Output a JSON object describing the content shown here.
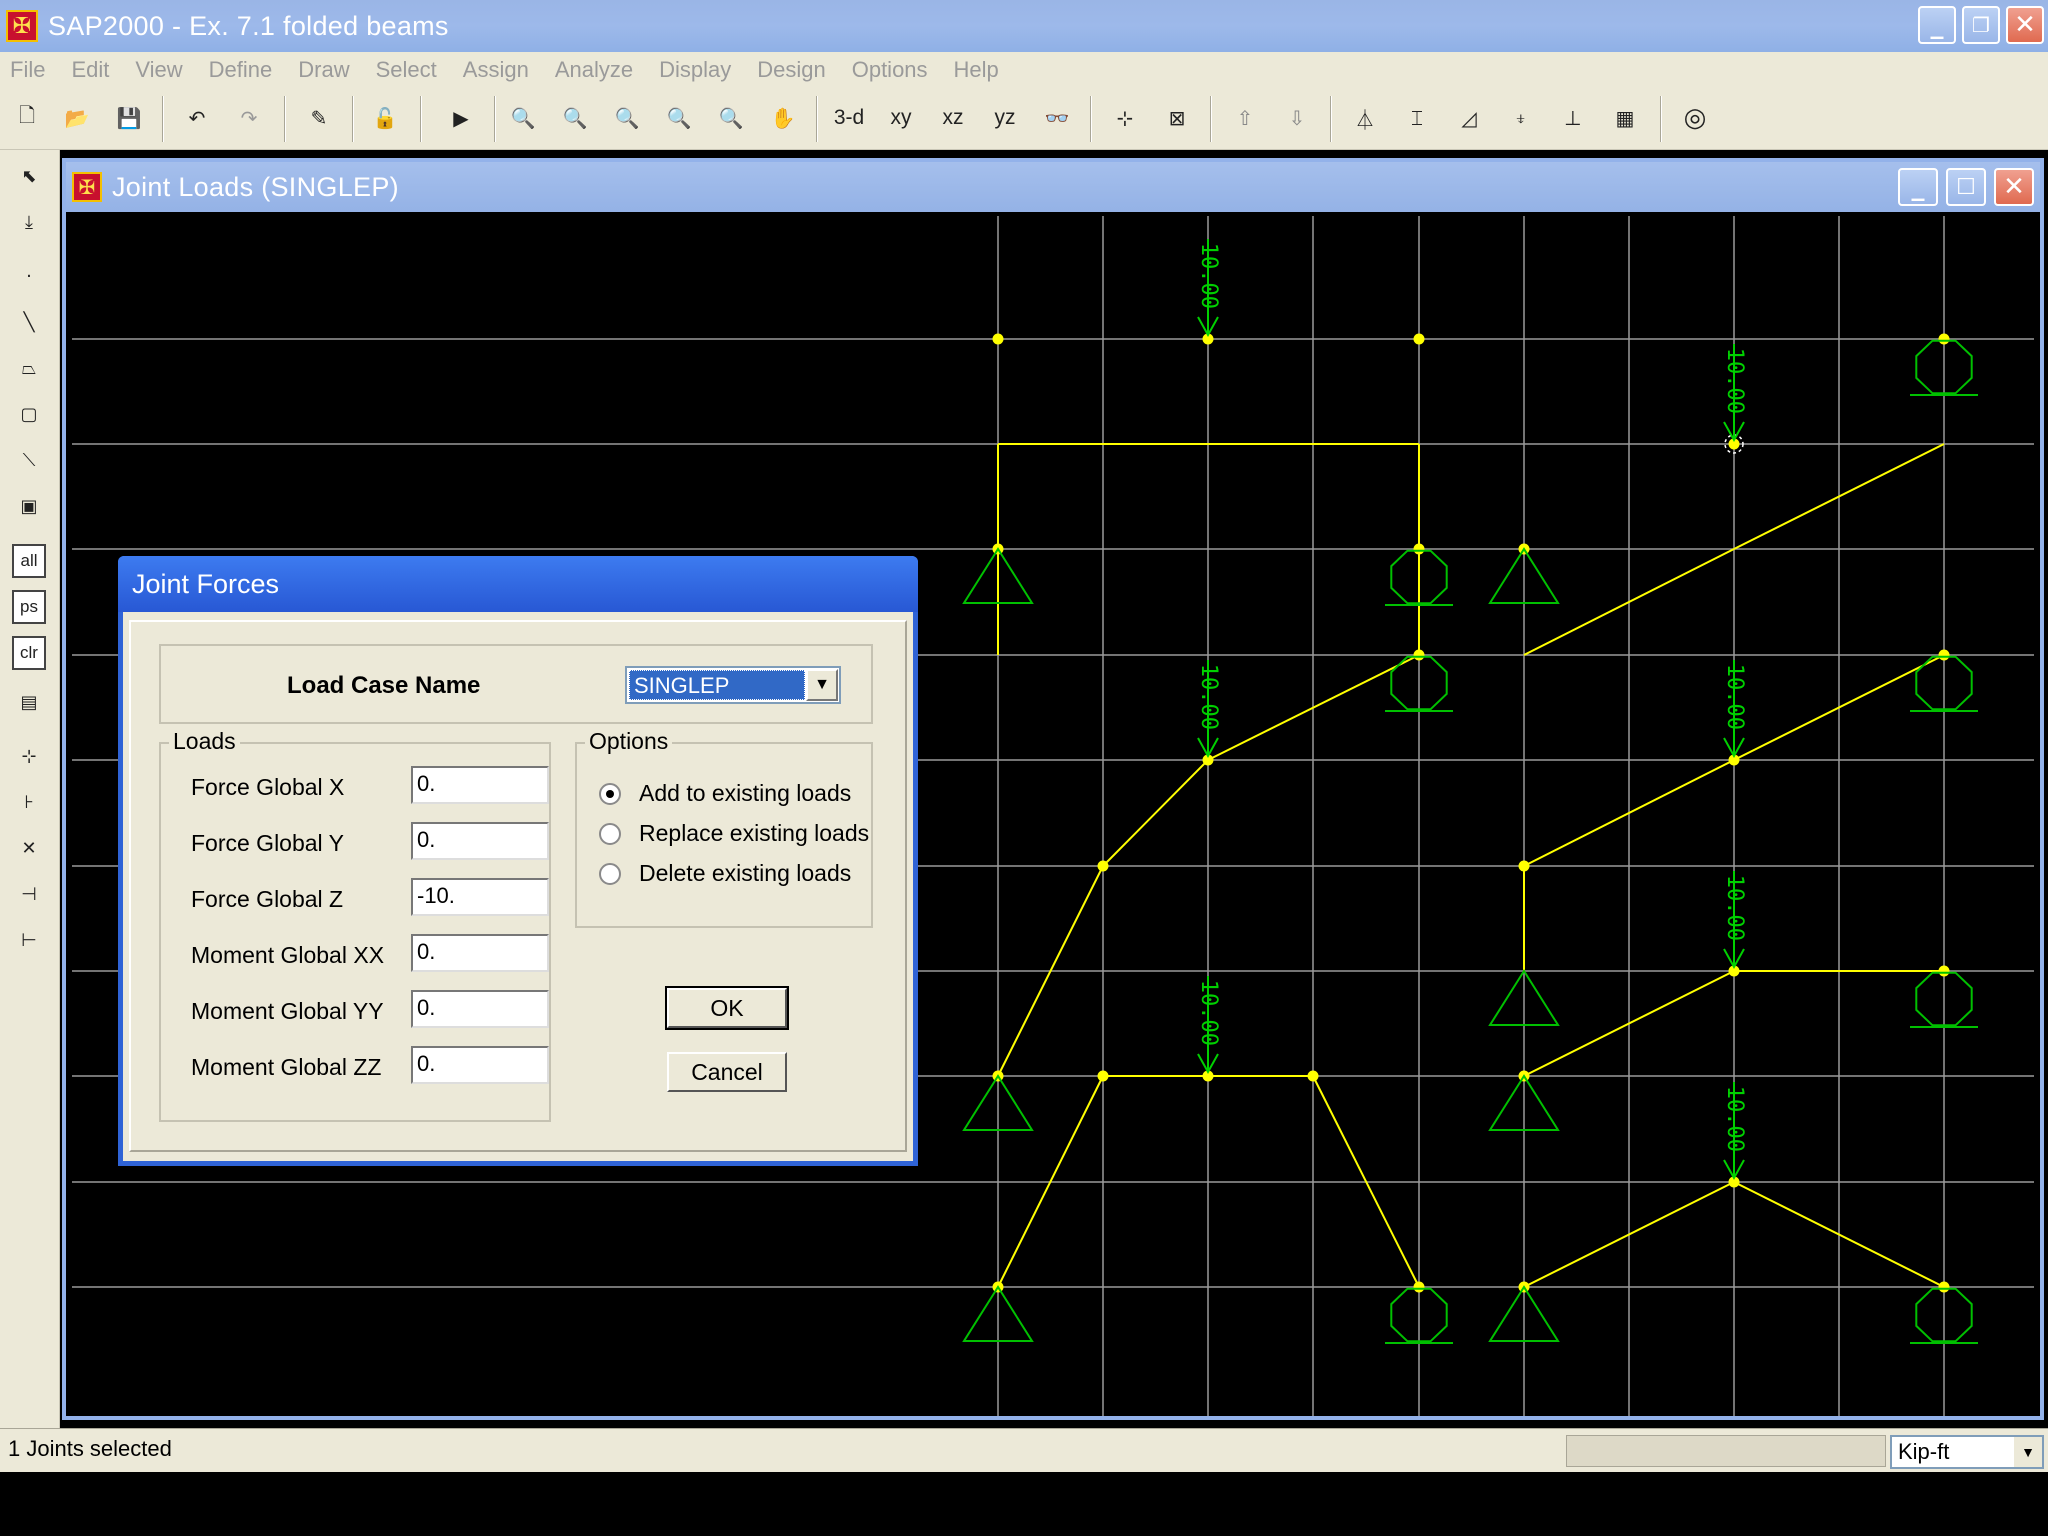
{
  "app": {
    "title": "SAP2000 - Ex. 7.1 folded beams",
    "icon_glyph": "✠"
  },
  "menu": [
    "File",
    "Edit",
    "View",
    "Define",
    "Draw",
    "Select",
    "Assign",
    "Analyze",
    "Display",
    "Design",
    "Options",
    "Help"
  ],
  "toolbar": {
    "view_3d": "3-d",
    "view_xy": "xy",
    "view_xz": "xz",
    "view_yz": "yz"
  },
  "left_toolbar": {
    "select_all": "all",
    "select_ps": "ps",
    "clear": "clr"
  },
  "child_window": {
    "title": "Joint Loads (SINGLEP)"
  },
  "canvas": {
    "load_label": "10.00",
    "colors": {
      "grid": "#9a9a9a",
      "frame": "#ffff00",
      "support": "#00c000",
      "load": "#00d000"
    }
  },
  "dialog": {
    "title": "Joint Forces",
    "load_case_label": "Load Case Name",
    "load_case_value": "SINGLEP",
    "loads_group": "Loads",
    "fields": [
      {
        "label": "Force Global X",
        "value": "0."
      },
      {
        "label": "Force Global Y",
        "value": "0."
      },
      {
        "label": "Force Global Z",
        "value": "-10."
      },
      {
        "label": "Moment Global XX",
        "value": "0."
      },
      {
        "label": "Moment Global YY",
        "value": "0."
      },
      {
        "label": "Moment Global ZZ",
        "value": "0."
      }
    ],
    "options_group": "Options",
    "options": [
      {
        "label": "Add to existing loads",
        "selected": true
      },
      {
        "label": "Replace existing loads",
        "selected": false
      },
      {
        "label": "Delete existing loads",
        "selected": false
      }
    ],
    "ok_label": "OK",
    "cancel_label": "Cancel"
  },
  "status": {
    "text": "1 Joints selected",
    "units": "Kip-ft"
  }
}
